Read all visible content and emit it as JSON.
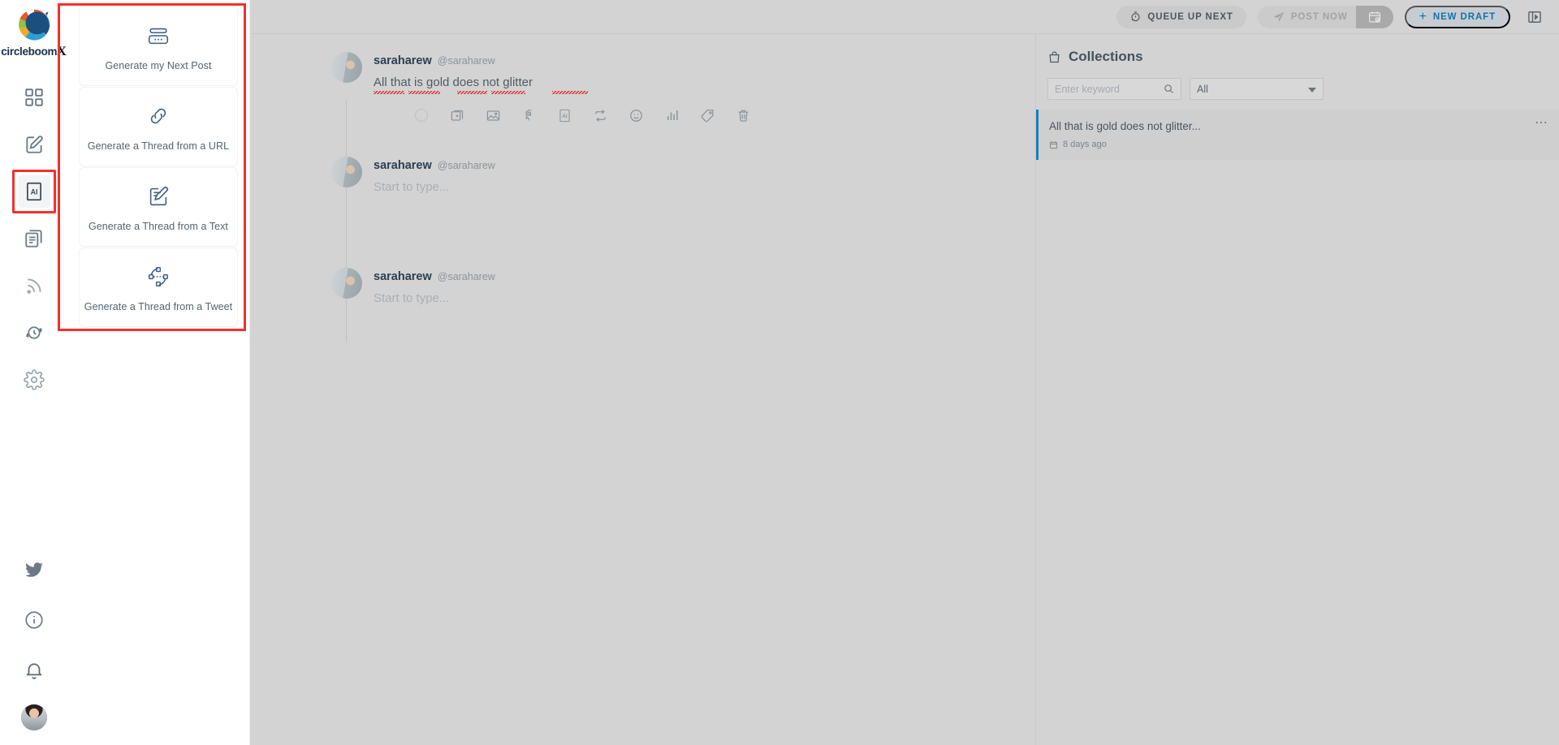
{
  "brand": {
    "name": "circleboom",
    "suffix": "X",
    "logo_colors": [
      "#1b4f7e",
      "#e8582c",
      "#f0a92e",
      "#8cc63e",
      "#2a9fd6",
      "#2b6cb0"
    ]
  },
  "sidebar": {
    "items": [
      {
        "id": "dashboard",
        "icon": "grid-icon",
        "label": "Dashboard",
        "active": false
      },
      {
        "id": "create",
        "icon": "compose-icon",
        "label": "Create",
        "active": false
      },
      {
        "id": "ai",
        "icon": "ai-icon",
        "label": "AI",
        "active": true,
        "highlighted": true
      },
      {
        "id": "queue",
        "icon": "copy-stack-icon",
        "label": "Queue",
        "active": false
      },
      {
        "id": "rss",
        "icon": "rss-icon",
        "label": "RSS",
        "active": false
      },
      {
        "id": "history",
        "icon": "clock-refresh-icon",
        "label": "History",
        "active": false
      },
      {
        "id": "settings",
        "icon": "gear-icon",
        "label": "Settings",
        "active": false
      }
    ],
    "bottom_items": [
      {
        "id": "twitter",
        "icon": "twitter-bird-icon",
        "label": "Twitter"
      },
      {
        "id": "info",
        "icon": "info-circle-icon",
        "label": "Info"
      },
      {
        "id": "notifications",
        "icon": "bell-icon",
        "label": "Notifications"
      }
    ],
    "avatar": {
      "icon": "avatar",
      "label": "Account"
    }
  },
  "ai_panel": {
    "cards": [
      {
        "id": "next-post",
        "icon": "generate-post-icon",
        "label": "Generate my Next Post"
      },
      {
        "id": "thread-url",
        "icon": "link-icon",
        "label": "Generate a Thread from a URL"
      },
      {
        "id": "thread-text",
        "icon": "edit-note-icon",
        "label": "Generate a Thread from a Text"
      },
      {
        "id": "thread-tweet",
        "icon": "repost-network-icon",
        "label": "Generate a Thread from a Tweet"
      }
    ],
    "highlight_color": "#f2302e"
  },
  "header": {
    "queue_label": "QUEUE UP NEXT",
    "post_now_label": "POST NOW",
    "new_draft_label": "NEW DRAFT",
    "new_draft_plus": "+",
    "queue_icon": "stopwatch-icon",
    "post_icon": "paper-plane-icon",
    "schedule_icon": "calendar-check-icon",
    "collapse_icon": "panel-collapse-icon",
    "accent_color": "#1572a8"
  },
  "composer": {
    "posts": [
      {
        "name": "saraharew",
        "handle": "@saraharew",
        "text": "All that is gold does not glitter",
        "placeholder": null,
        "has_toolbar": true,
        "spellcheck_words": [
          "All",
          "that",
          "gold",
          "does",
          "glitter"
        ]
      },
      {
        "name": "saraharew",
        "handle": "@saraharew",
        "text": null,
        "placeholder": "Start to type...",
        "has_toolbar": false
      },
      {
        "name": "saraharew",
        "handle": "@saraharew",
        "text": null,
        "placeholder": "Start to type...",
        "has_toolbar": false
      }
    ],
    "toolbar": [
      {
        "id": "char-count",
        "icon": "progress-ring-icon",
        "label": "Character count"
      },
      {
        "id": "add-post",
        "icon": "add-card-icon",
        "label": "Add post"
      },
      {
        "id": "add-image",
        "icon": "image-icon",
        "label": "Add image"
      },
      {
        "id": "ai-assist",
        "icon": "brain-icon",
        "label": "AI assist"
      },
      {
        "id": "ai-text",
        "icon": "ai-icon",
        "label": "AI"
      },
      {
        "id": "retweet",
        "icon": "repeat-icon",
        "label": "Repost"
      },
      {
        "id": "emoji",
        "icon": "emoji-icon",
        "label": "Emoji"
      },
      {
        "id": "poll",
        "icon": "poll-bars-icon",
        "label": "Poll"
      },
      {
        "id": "tag",
        "icon": "tag-icon",
        "label": "Tag"
      },
      {
        "id": "delete",
        "icon": "trash-icon",
        "label": "Delete"
      }
    ]
  },
  "collections": {
    "title": "Collections",
    "title_icon": "bag-icon",
    "search_placeholder": "Enter keyword",
    "search_value": "",
    "search_icon": "search-icon",
    "filter_selected": "All",
    "filter_options": [
      "All"
    ],
    "items": [
      {
        "title": "All that is gold does not glitter...",
        "meta": "8 days ago",
        "meta_icon": "calendar-icon",
        "more_icon": "more-dots-icon",
        "accent": "#1a7fb8",
        "selected": true
      }
    ]
  }
}
